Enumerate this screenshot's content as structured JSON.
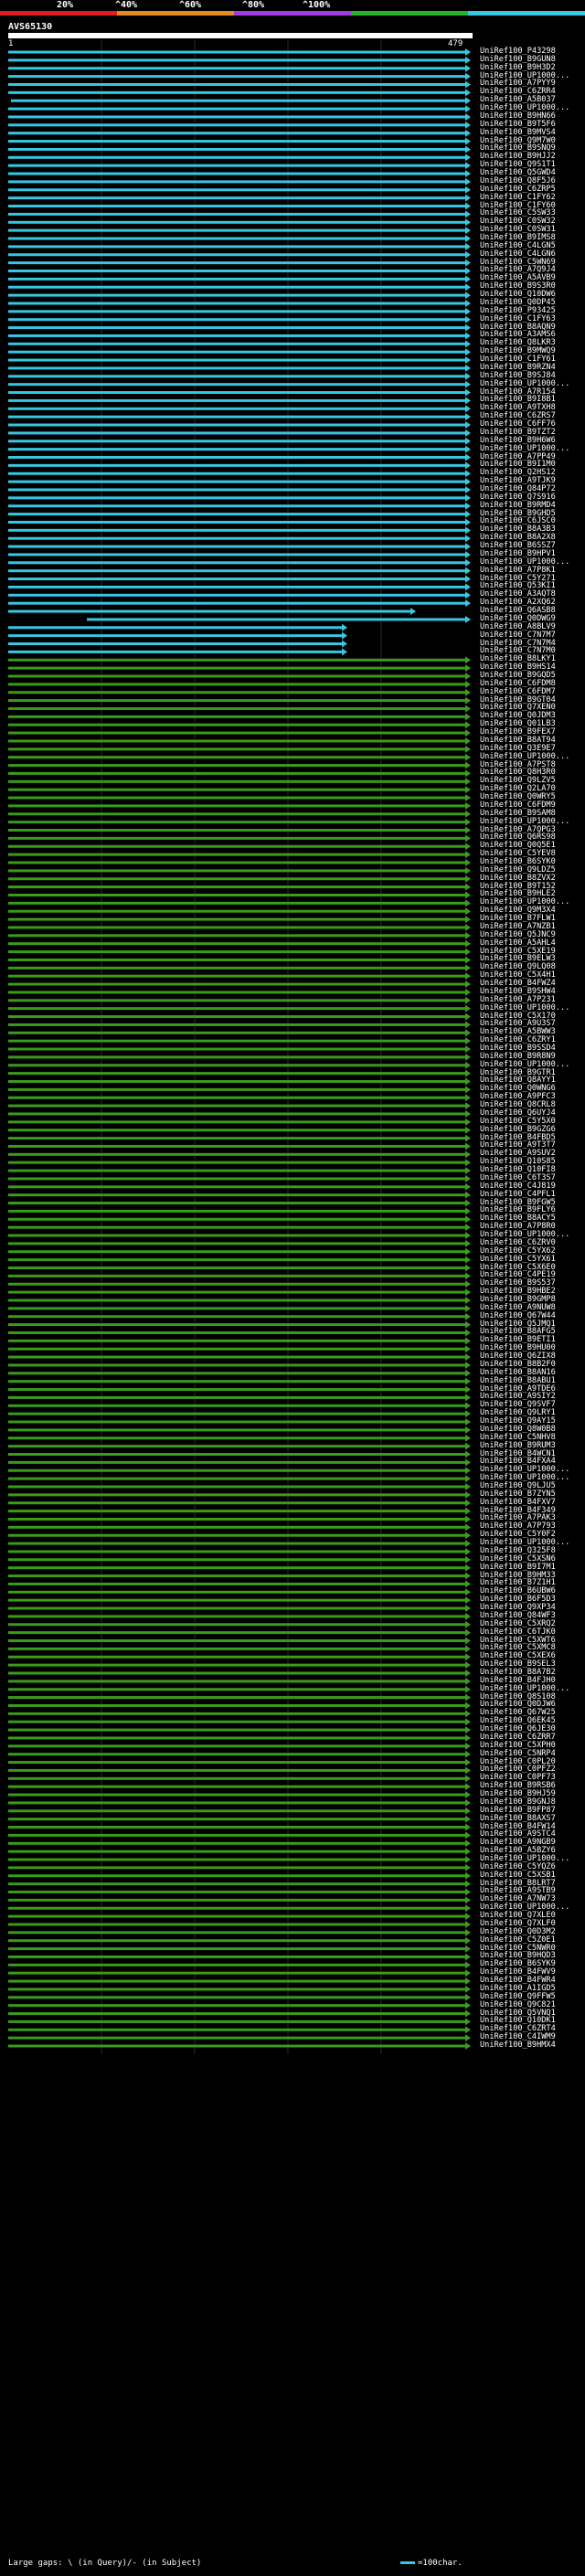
{
  "scale": {
    "labels": [
      "20%",
      "^40%",
      "^60%",
      "^80%",
      "^100%"
    ],
    "colors": [
      "#e01e1e",
      "#e58a1b",
      "#a23ce0",
      "#27b526",
      "#39c6e0"
    ]
  },
  "query": {
    "name": "AVS65130",
    "start": "1",
    "end": "479"
  },
  "colors": {
    "cyan": "#39c6e0",
    "green": "#3a9b1c",
    "grid": "#ffffff"
  },
  "hits": [
    {
      "label": "UniRef100_P43298",
      "color": "cyan"
    },
    {
      "label": "UniRef100_B9GUN8",
      "color": "cyan"
    },
    {
      "label": "UniRef100_B9H3D2",
      "color": "cyan"
    },
    {
      "label": "UniRef100_UP1000...",
      "color": "cyan"
    },
    {
      "label": "UniRef100_A7PYY9",
      "color": "cyan"
    },
    {
      "label": "UniRef100_C6ZRR4",
      "color": "cyan"
    },
    {
      "label": "UniRef100_A5B037",
      "color": "cyan"
    },
    {
      "label": "UniRef100_UP1000...",
      "color": "cyan"
    },
    {
      "label": "UniRef100_B9HN66",
      "color": "cyan"
    },
    {
      "label": "UniRef100_B9T5F6",
      "color": "cyan"
    },
    {
      "label": "UniRef100_B9MVS4",
      "color": "cyan"
    },
    {
      "label": "UniRef100_Q9M7W0",
      "color": "cyan"
    },
    {
      "label": "UniRef100_B9SNQ9",
      "color": "cyan"
    },
    {
      "label": "UniRef100_B9HJJ2",
      "color": "cyan"
    },
    {
      "label": "UniRef100_Q9S1T1",
      "color": "cyan"
    },
    {
      "label": "UniRef100_Q5GWD4",
      "color": "cyan"
    },
    {
      "label": "UniRef100_Q8F5J6",
      "color": "cyan"
    },
    {
      "label": "UniRef100_C6ZRP5",
      "color": "cyan"
    },
    {
      "label": "UniRef100_C1FY62",
      "color": "cyan"
    },
    {
      "label": "UniRef100_C1FY60",
      "color": "cyan"
    },
    {
      "label": "UniRef100_C5SW33",
      "color": "cyan"
    },
    {
      "label": "UniRef100_C0SW32",
      "color": "cyan"
    },
    {
      "label": "UniRef100_C0SW31",
      "color": "cyan"
    },
    {
      "label": "UniRef100_B9IMS8",
      "color": "cyan"
    },
    {
      "label": "UniRef100_C4LGN5",
      "color": "cyan"
    },
    {
      "label": "UniRef100_C4LGN6",
      "color": "cyan"
    },
    {
      "label": "UniRef100_C5WN69",
      "color": "cyan"
    },
    {
      "label": "UniRef100_A7Q9J4",
      "color": "cyan"
    },
    {
      "label": "UniRef100_A5AVB9",
      "color": "cyan"
    },
    {
      "label": "UniRef100_B9S3R0",
      "color": "cyan"
    },
    {
      "label": "UniRef100_Q10DW6",
      "color": "cyan"
    },
    {
      "label": "UniRef100_Q0DP45",
      "color": "cyan"
    },
    {
      "label": "UniRef100_P93425",
      "color": "cyan"
    },
    {
      "label": "UniRef100_C1FY63",
      "color": "cyan"
    },
    {
      "label": "UniRef100_B8AQN9",
      "color": "cyan"
    },
    {
      "label": "UniRef100_A3AMS6",
      "color": "cyan"
    },
    {
      "label": "UniRef100_Q8LKR3",
      "color": "cyan"
    },
    {
      "label": "UniRef100_B9MWQ9",
      "color": "cyan"
    },
    {
      "label": "UniRef100_C1FY61",
      "color": "cyan"
    },
    {
      "label": "UniRef100_B9RZN4",
      "color": "cyan"
    },
    {
      "label": "UniRef100_B9SJ84",
      "color": "cyan"
    },
    {
      "label": "UniRef100_UP1000...",
      "color": "cyan"
    },
    {
      "label": "UniRef100_A7R154",
      "color": "cyan"
    },
    {
      "label": "UniRef100_B9I8B1",
      "color": "cyan"
    },
    {
      "label": "UniRef100_A9TXH8",
      "color": "cyan"
    },
    {
      "label": "UniRef100_C6ZRS7",
      "color": "cyan"
    },
    {
      "label": "UniRef100_C6FF76",
      "color": "cyan"
    },
    {
      "label": "UniRef100_B9TZT2",
      "color": "cyan"
    },
    {
      "label": "UniRef100_B9H6W6",
      "color": "cyan"
    },
    {
      "label": "UniRef100_UP1000...",
      "color": "cyan"
    },
    {
      "label": "UniRef100_A7PP49",
      "color": "cyan"
    },
    {
      "label": "UniRef100_B9I1M0",
      "color": "cyan"
    },
    {
      "label": "UniRef100_Q2HS12",
      "color": "cyan"
    },
    {
      "label": "UniRef100_A9TJK9",
      "color": "cyan"
    },
    {
      "label": "UniRef100_Q84P72",
      "color": "cyan"
    },
    {
      "label": "UniRef100_Q7S916",
      "color": "cyan"
    },
    {
      "label": "UniRef100_B9RMD4",
      "color": "cyan"
    },
    {
      "label": "UniRef100_B9GHD5",
      "color": "cyan"
    },
    {
      "label": "UniRef100_C6JSC0",
      "color": "cyan"
    },
    {
      "label": "UniRef100_B8A3B3",
      "color": "cyan"
    },
    {
      "label": "UniRef100_B8A2X8",
      "color": "cyan"
    },
    {
      "label": "UniRef100_B6SSZ7",
      "color": "cyan"
    },
    {
      "label": "UniRef100_B9HPV1",
      "color": "cyan"
    },
    {
      "label": "UniRef100_UP1000...",
      "color": "cyan"
    },
    {
      "label": "UniRef100_A7P8K1",
      "color": "cyan"
    },
    {
      "label": "UniRef100_C5Y271",
      "color": "cyan"
    },
    {
      "label": "UniRef100_Q53KI1",
      "color": "cyan"
    },
    {
      "label": "UniRef100_A3AQT8",
      "color": "cyan"
    },
    {
      "label": "UniRef100_A2XQ62",
      "color": "cyan"
    },
    {
      "label": "UniRef100_Q6ASB8",
      "color": "cyan"
    },
    {
      "label": "UniRef100_Q0DWG9",
      "color": "cyan"
    },
    {
      "label": "UniRef100_A8BLV9",
      "color": "cyan"
    },
    {
      "label": "UniRef100_C7N7M7",
      "color": "cyan"
    },
    {
      "label": "UniRef100_C7N7M4",
      "color": "cyan"
    },
    {
      "label": "UniRef100_C7N7M0",
      "color": "cyan"
    },
    {
      "label": "UniRef100_B8LKY1",
      "color": "green"
    },
    {
      "label": "UniRef100_B9HS14",
      "color": "green"
    },
    {
      "label": "UniRef100_B9GQD5",
      "color": "green"
    },
    {
      "label": "UniRef100_C6FDM8",
      "color": "green"
    },
    {
      "label": "UniRef100_C6FDM7",
      "color": "green"
    },
    {
      "label": "UniRef100_B9GT04",
      "color": "green"
    },
    {
      "label": "UniRef100_Q7XEN0",
      "color": "green"
    },
    {
      "label": "UniRef100_Q0JDM3",
      "color": "green"
    },
    {
      "label": "UniRef100_Q01LB3",
      "color": "green"
    },
    {
      "label": "UniRef100_B9FEX7",
      "color": "green"
    },
    {
      "label": "UniRef100_B8AT94",
      "color": "green"
    },
    {
      "label": "UniRef100_Q3E9E7",
      "color": "green"
    },
    {
      "label": "UniRef100_UP1000...",
      "color": "green"
    },
    {
      "label": "UniRef100_A7PST8",
      "color": "green"
    },
    {
      "label": "UniRef100_Q8H3R0",
      "color": "green"
    },
    {
      "label": "UniRef100_Q9LZV5",
      "color": "green"
    },
    {
      "label": "UniRef100_Q2LA70",
      "color": "green"
    },
    {
      "label": "UniRef100_Q0WRY5",
      "color": "green"
    },
    {
      "label": "UniRef100_C6FDM9",
      "color": "green"
    },
    {
      "label": "UniRef100_B9SAM8",
      "color": "green"
    },
    {
      "label": "UniRef100_UP1000...",
      "color": "green"
    },
    {
      "label": "UniRef100_A7QPG3",
      "color": "green"
    },
    {
      "label": "UniRef100_Q6RS98",
      "color": "green"
    },
    {
      "label": "UniRef100_Q0Q5E1",
      "color": "green"
    },
    {
      "label": "UniRef100_C5YEV8",
      "color": "green"
    },
    {
      "label": "UniRef100_B6SYK0",
      "color": "green"
    },
    {
      "label": "UniRef100_Q9LDZ5",
      "color": "green"
    },
    {
      "label": "UniRef100_B8ZVX2",
      "color": "green"
    },
    {
      "label": "UniRef100_B9T152",
      "color": "green"
    },
    {
      "label": "UniRef100_B9HLE2",
      "color": "green"
    },
    {
      "label": "UniRef100_UP1000...",
      "color": "green"
    },
    {
      "label": "UniRef100_Q9M3X4",
      "color": "green"
    },
    {
      "label": "UniRef100_B7FLW1",
      "color": "green"
    },
    {
      "label": "UniRef100_A7NZB1",
      "color": "green"
    },
    {
      "label": "UniRef100_Q5JNC9",
      "color": "green"
    },
    {
      "label": "UniRef100_A5AHL4",
      "color": "green"
    },
    {
      "label": "UniRef100_C5XE19",
      "color": "green"
    },
    {
      "label": "UniRef100_B9ELW3",
      "color": "green"
    },
    {
      "label": "UniRef100_Q9LQ08",
      "color": "green"
    },
    {
      "label": "UniRef100_C5X4H1",
      "color": "green"
    },
    {
      "label": "UniRef100_B4FWZ4",
      "color": "green"
    },
    {
      "label": "UniRef100_B9SHW4",
      "color": "green"
    },
    {
      "label": "UniRef100_A7P231",
      "color": "green"
    },
    {
      "label": "UniRef100_UP1000...",
      "color": "green"
    },
    {
      "label": "UniRef100_C5X170",
      "color": "green"
    },
    {
      "label": "UniRef100_A9U3S7",
      "color": "green"
    },
    {
      "label": "UniRef100_A5BWW3",
      "color": "green"
    },
    {
      "label": "UniRef100_C6ZRY1",
      "color": "green"
    },
    {
      "label": "UniRef100_B9SSD4",
      "color": "green"
    },
    {
      "label": "UniRef100_B9R8N9",
      "color": "green"
    },
    {
      "label": "UniRef100_UP1000...",
      "color": "green"
    },
    {
      "label": "UniRef100_B9GTR1",
      "color": "green"
    },
    {
      "label": "UniRef100_Q8AYY1",
      "color": "green"
    },
    {
      "label": "UniRef100_Q0WNG6",
      "color": "green"
    },
    {
      "label": "UniRef100_A9PFC3",
      "color": "green"
    },
    {
      "label": "UniRef100_Q8CRL8",
      "color": "green"
    },
    {
      "label": "UniRef100_Q6UYJ4",
      "color": "green"
    },
    {
      "label": "UniRef100_C5Y5X0",
      "color": "green"
    },
    {
      "label": "UniRef100_B9GZG6",
      "color": "green"
    },
    {
      "label": "UniRef100_B4FBD5",
      "color": "green"
    },
    {
      "label": "UniRef100_A9T3T7",
      "color": "green"
    },
    {
      "label": "UniRef100_A9SUV2",
      "color": "green"
    },
    {
      "label": "UniRef100_Q10S85",
      "color": "green"
    },
    {
      "label": "UniRef100_Q10FI8",
      "color": "green"
    },
    {
      "label": "UniRef100_C6T3S7",
      "color": "green"
    },
    {
      "label": "UniRef100_C4J819",
      "color": "green"
    },
    {
      "label": "UniRef100_C4PFL1",
      "color": "green"
    },
    {
      "label": "UniRef100_B9FGW5",
      "color": "green"
    },
    {
      "label": "UniRef100_B9FLY6",
      "color": "green"
    },
    {
      "label": "UniRef100_B8ACY5",
      "color": "green"
    },
    {
      "label": "UniRef100_A7P8R0",
      "color": "green"
    },
    {
      "label": "UniRef100_UP1000...",
      "color": "green"
    },
    {
      "label": "UniRef100_C6ZRV0",
      "color": "green"
    },
    {
      "label": "UniRef100_C5YX62",
      "color": "green"
    },
    {
      "label": "UniRef100_C5YX61",
      "color": "green"
    },
    {
      "label": "UniRef100_C5X6E0",
      "color": "green"
    },
    {
      "label": "UniRef100_C4PE19",
      "color": "green"
    },
    {
      "label": "UniRef100_B9S537",
      "color": "green"
    },
    {
      "label": "UniRef100_B9HBE2",
      "color": "green"
    },
    {
      "label": "UniRef100_B9GMP8",
      "color": "green"
    },
    {
      "label": "UniRef100_A9NUW8",
      "color": "green"
    },
    {
      "label": "UniRef100_Q67W44",
      "color": "green"
    },
    {
      "label": "UniRef100_Q5JMQ1",
      "color": "green"
    },
    {
      "label": "UniRef100_B8AFG5",
      "color": "green"
    },
    {
      "label": "UniRef100_B9ETI1",
      "color": "green"
    },
    {
      "label": "UniRef100_B9HU00",
      "color": "green"
    },
    {
      "label": "UniRef100_Q6ZIX8",
      "color": "green"
    },
    {
      "label": "UniRef100_B8B2F0",
      "color": "green"
    },
    {
      "label": "UniRef100_B8AN16",
      "color": "green"
    },
    {
      "label": "UniRef100_B8ABU1",
      "color": "green"
    },
    {
      "label": "UniRef100_A9TDE6",
      "color": "green"
    },
    {
      "label": "UniRef100_A9SIY2",
      "color": "green"
    },
    {
      "label": "UniRef100_Q9SVF7",
      "color": "green"
    },
    {
      "label": "UniRef100_Q9LRY1",
      "color": "green"
    },
    {
      "label": "UniRef100_Q9AY15",
      "color": "green"
    },
    {
      "label": "UniRef100_Q8W0B8",
      "color": "green"
    },
    {
      "label": "UniRef100_C5NHV8",
      "color": "green"
    },
    {
      "label": "UniRef100_B9RUM3",
      "color": "green"
    },
    {
      "label": "UniRef100_B4WCN1",
      "color": "green"
    },
    {
      "label": "UniRef100_B4FXA4",
      "color": "green"
    },
    {
      "label": "UniRef100_UP1000...",
      "color": "green"
    },
    {
      "label": "UniRef100_UP1000...",
      "color": "green"
    },
    {
      "label": "UniRef100_Q9LJU5",
      "color": "green"
    },
    {
      "label": "UniRef100_B7ZYN5",
      "color": "green"
    },
    {
      "label": "UniRef100_B4FXV7",
      "color": "green"
    },
    {
      "label": "UniRef100_B4F349",
      "color": "green"
    },
    {
      "label": "UniRef100_A7PAK3",
      "color": "green"
    },
    {
      "label": "UniRef100_A7P793",
      "color": "green"
    },
    {
      "label": "UniRef100_C5Y0F2",
      "color": "green"
    },
    {
      "label": "UniRef100_UP1000...",
      "color": "green"
    },
    {
      "label": "UniRef100_Q325F8",
      "color": "green"
    },
    {
      "label": "UniRef100_C5XSN6",
      "color": "green"
    },
    {
      "label": "UniRef100_B9I7M1",
      "color": "green"
    },
    {
      "label": "UniRef100_B9HM33",
      "color": "green"
    },
    {
      "label": "UniRef100_B7Z1H1",
      "color": "green"
    },
    {
      "label": "UniRef100_B6UBW6",
      "color": "green"
    },
    {
      "label": "UniRef100_B6F5D3",
      "color": "green"
    },
    {
      "label": "UniRef100_Q9XP34",
      "color": "green"
    },
    {
      "label": "UniRef100_Q84WF3",
      "color": "green"
    },
    {
      "label": "UniRef100_C5XRQ2",
      "color": "green"
    },
    {
      "label": "UniRef100_C6TJK0",
      "color": "green"
    },
    {
      "label": "UniRef100_C5XWT6",
      "color": "green"
    },
    {
      "label": "UniRef100_C5XMC8",
      "color": "green"
    },
    {
      "label": "UniRef100_C5XEX6",
      "color": "green"
    },
    {
      "label": "UniRef100_B9SEL3",
      "color": "green"
    },
    {
      "label": "UniRef100_B8A7B2",
      "color": "green"
    },
    {
      "label": "UniRef100_B4FJH0",
      "color": "green"
    },
    {
      "label": "UniRef100_UP1000...",
      "color": "green"
    },
    {
      "label": "UniRef100_Q8S108",
      "color": "green"
    },
    {
      "label": "UniRef100_Q0DJW6",
      "color": "green"
    },
    {
      "label": "UniRef100_Q67W25",
      "color": "green"
    },
    {
      "label": "UniRef100_Q6EK45",
      "color": "green"
    },
    {
      "label": "UniRef100_Q6JE30",
      "color": "green"
    },
    {
      "label": "UniRef100_C6ZRR7",
      "color": "green"
    },
    {
      "label": "UniRef100_C5XPH0",
      "color": "green"
    },
    {
      "label": "UniRef100_C5NRP4",
      "color": "green"
    },
    {
      "label": "UniRef100_C0PL20",
      "color": "green"
    },
    {
      "label": "UniRef100_C0PFZ2",
      "color": "green"
    },
    {
      "label": "UniRef100_C0PF73",
      "color": "green"
    },
    {
      "label": "UniRef100_B9RSB6",
      "color": "green"
    },
    {
      "label": "UniRef100_B9HJ59",
      "color": "green"
    },
    {
      "label": "UniRef100_B9GNJ8",
      "color": "green"
    },
    {
      "label": "UniRef100_B9FP87",
      "color": "green"
    },
    {
      "label": "UniRef100_B8AXS7",
      "color": "green"
    },
    {
      "label": "UniRef100_B4FW14",
      "color": "green"
    },
    {
      "label": "UniRef100_A9STC4",
      "color": "green"
    },
    {
      "label": "UniRef100_A9NGB9",
      "color": "green"
    },
    {
      "label": "UniRef100_A5BZY6",
      "color": "green"
    },
    {
      "label": "UniRef100_UP1000...",
      "color": "green"
    },
    {
      "label": "UniRef100_C5YQZ6",
      "color": "green"
    },
    {
      "label": "UniRef100_C5XSB1",
      "color": "green"
    },
    {
      "label": "UniRef100_B8LRT7",
      "color": "green"
    },
    {
      "label": "UniRef100_A9STB9",
      "color": "green"
    },
    {
      "label": "UniRef100_A7NW73",
      "color": "green"
    },
    {
      "label": "UniRef100_UP1000...",
      "color": "green"
    },
    {
      "label": "UniRef100_Q7XLE0",
      "color": "green"
    },
    {
      "label": "UniRef100_Q7XLF0",
      "color": "green"
    },
    {
      "label": "UniRef100_Q0D3M2",
      "color": "green"
    },
    {
      "label": "UniRef100_C5Z0E1",
      "color": "green"
    },
    {
      "label": "UniRef100_C5NWR0",
      "color": "green"
    },
    {
      "label": "UniRef100_B9HQD3",
      "color": "green"
    },
    {
      "label": "UniRef100_B6SYK9",
      "color": "green"
    },
    {
      "label": "UniRef100_B4FWV9",
      "color": "green"
    },
    {
      "label": "UniRef100_B4FWR4",
      "color": "green"
    },
    {
      "label": "UniRef100_A1IGD5",
      "color": "green"
    },
    {
      "label": "UniRef100_Q9FFW5",
      "color": "green"
    },
    {
      "label": "UniRef100_Q9C821",
      "color": "green"
    },
    {
      "label": "UniRef100_Q5VNQ1",
      "color": "green"
    },
    {
      "label": "UniRef100_Q10DK1",
      "color": "green"
    },
    {
      "label": "UniRef100_C6ZRT4",
      "color": "green"
    },
    {
      "label": "UniRef100_C4IWM9",
      "color": "green"
    },
    {
      "label": "UniRef100_B9HMX4",
      "color": "green"
    }
  ],
  "legend": {
    "left": "Large gaps: \\ (in Query)/- (in Subject)",
    "right": "=100char."
  }
}
